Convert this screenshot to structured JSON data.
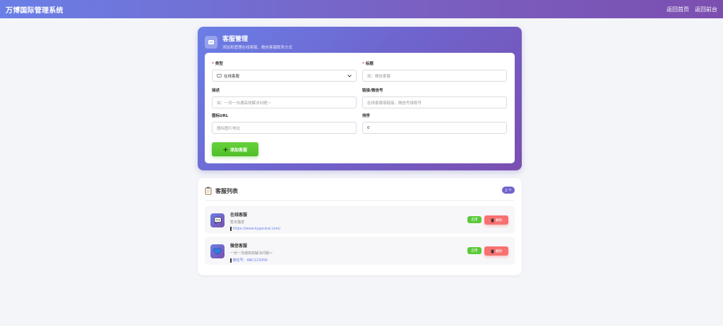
{
  "app": {
    "title": "万博国际管理系统"
  },
  "nav": {
    "home_label": "返回首页",
    "back_label": "返回前台"
  },
  "manage": {
    "title": "客服管理",
    "subtitle": "添加和管理在线客服、微信客服联系方式",
    "form": {
      "type_label": "类型",
      "type_value": "在线客服",
      "title_label": "标题",
      "title_placeholder": "如：微信客服",
      "desc_label": "描述",
      "desc_placeholder": "如：一对一沟通高效解决问题～",
      "link_label": "链接/微信号",
      "link_placeholder": "在线客服填链接，微信号填账号",
      "icon_label": "图标URL",
      "icon_placeholder": "图标图片地址",
      "sort_label": "排序",
      "sort_value": "0",
      "add_button": "添加客服"
    }
  },
  "list": {
    "title": "客服列表",
    "count": "2 个",
    "items": [
      {
        "name": "在线客服",
        "desc": "暂无描述",
        "extra": "https://www.kygoukai.com/",
        "status": "启用",
        "delete": "删除",
        "icon": "chat-icon"
      },
      {
        "name": "微信客服",
        "desc": "一对一沟通高效解决问题～",
        "extra": "微信号：ABC123456",
        "status": "启用",
        "delete": "删除",
        "icon": "heart-icon"
      }
    ]
  }
}
